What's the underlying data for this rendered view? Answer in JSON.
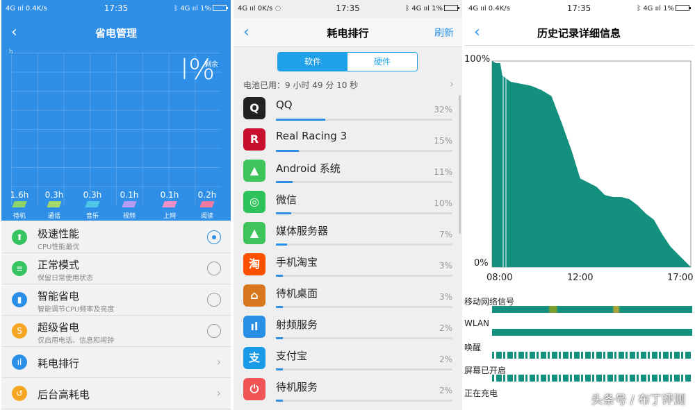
{
  "panel1": {
    "status": {
      "left": "4G ııl 0.4K/s",
      "time": "17:35",
      "right": "ᛒ 4G ııl 1%"
    },
    "title": "省电管理",
    "back": "‹",
    "axis_h": "h",
    "percent": "l%",
    "remain": "剩余",
    "usage": [
      {
        "value": "1.6h",
        "label": "待机",
        "color": "#8fd36b"
      },
      {
        "value": "0.3h",
        "label": "通话",
        "color": "#a5d86a"
      },
      {
        "value": "0.3h",
        "label": "音乐",
        "color": "#4fc6e8"
      },
      {
        "value": "0.1h",
        "label": "视频",
        "color": "#b69af0"
      },
      {
        "value": "0.1h",
        "label": "上网",
        "color": "#f08fc8"
      },
      {
        "value": "0.2h",
        "label": "阅读",
        "color": "#f07aa0"
      }
    ],
    "modes": [
      {
        "title": "极速性能",
        "sub": "CPU性能最优",
        "icon": "rocket-icon",
        "glyph": "⬆",
        "color": "#35c460",
        "kind": "radio",
        "selected": true
      },
      {
        "title": "正常模式",
        "sub": "保留日常使用状态",
        "icon": "list-icon",
        "glyph": "≡",
        "color": "#35c460",
        "kind": "radio",
        "selected": false
      },
      {
        "title": "智能省电",
        "sub": "智能调节CPU频率及亮度",
        "icon": "battery-icon",
        "glyph": "▮",
        "color": "#2a8fe6",
        "kind": "radio",
        "selected": false
      },
      {
        "title": "超级省电",
        "sub": "仅启用电话、信息和闹钟",
        "icon": "save-icon",
        "glyph": "S",
        "color": "#f5a623",
        "kind": "radio",
        "selected": false
      },
      {
        "title": "耗电排行",
        "sub": "",
        "icon": "bar-chart-icon",
        "glyph": "ıl",
        "color": "#2a8fe6",
        "kind": "link",
        "selected": false
      },
      {
        "title": "后台高耗电",
        "sub": "",
        "icon": "refresh-icon",
        "glyph": "↺",
        "color": "#f5a623",
        "kind": "link",
        "selected": false
      }
    ]
  },
  "panel2": {
    "status": {
      "left": "4G ııl 0K/s ◌",
      "time": "17:35",
      "right": "ᛒ 4G ııl 1%"
    },
    "title": "耗电排行",
    "back": "‹",
    "refresh": "刷新",
    "tabs": [
      "软件",
      "硬件"
    ],
    "battery_used": "电池已用：9 小时 49 分 10 秒",
    "apps": [
      {
        "name": "QQ",
        "percent": "32%",
        "value": 32,
        "icon": "qq-icon",
        "glyph": "Q",
        "color": "#222"
      },
      {
        "name": "Real Racing 3",
        "percent": "15%",
        "value": 15,
        "icon": "real-racing-icon",
        "glyph": "R",
        "color": "#c8102e"
      },
      {
        "name": "Android 系统",
        "percent": "11%",
        "value": 11,
        "icon": "android-icon",
        "glyph": "▲",
        "color": "#3ec45a"
      },
      {
        "name": "微信",
        "percent": "10%",
        "value": 10,
        "icon": "wechat-icon",
        "glyph": "◎",
        "color": "#2ec25b"
      },
      {
        "name": "媒体服务器",
        "percent": "7%",
        "value": 7,
        "icon": "android-icon",
        "glyph": "▲",
        "color": "#3ec45a"
      },
      {
        "name": "手机淘宝",
        "percent": "3%",
        "value": 3,
        "icon": "taobao-icon",
        "glyph": "淘",
        "color": "#ff5000"
      },
      {
        "name": "待机桌面",
        "percent": "3%",
        "value": 3,
        "icon": "home-icon",
        "glyph": "⌂",
        "color": "#d9771e"
      },
      {
        "name": "射频服务",
        "percent": "2%",
        "value": 2,
        "icon": "signal-icon",
        "glyph": "ıl",
        "color": "#2a8fe6"
      },
      {
        "name": "支付宝",
        "percent": "2%",
        "value": 2,
        "icon": "alipay-icon",
        "glyph": "支",
        "color": "#1a9be8"
      },
      {
        "name": "待机服务",
        "percent": "2%",
        "value": 2,
        "icon": "power-icon",
        "glyph": "⏻",
        "color": "#f05454"
      }
    ]
  },
  "panel3": {
    "status": {
      "left": "4G ııl 0.4K/s",
      "time": "17:35",
      "right": "ᛒ 4G ııl 1%"
    },
    "title": "历史记录详细信息",
    "back": "‹",
    "chart_data": {
      "type": "area",
      "x_ticks": [
        "08:00",
        "12:00",
        "17:00"
      ],
      "y_ticks": [
        "100%",
        "0%"
      ],
      "series_color": "#13907e",
      "x_hours": [
        7.6,
        7.8,
        8.0,
        8.1,
        8.5,
        9.0,
        9.5,
        10.0,
        10.5,
        11.0,
        11.5,
        11.9,
        12.3,
        12.7,
        13.1,
        13.5,
        13.9,
        14.3,
        14.7,
        15.1,
        15.5,
        15.9,
        16.3,
        16.7,
        17.0,
        17.3
      ],
      "y_percent": [
        100,
        99,
        99,
        93,
        90,
        89,
        88,
        86,
        83,
        70,
        56,
        43,
        41,
        39,
        35,
        34,
        34,
        33,
        30,
        26,
        23,
        16,
        10,
        6,
        3,
        0
      ],
      "x_range": [
        7.6,
        17.3
      ],
      "y_range": [
        0,
        100
      ]
    },
    "signals": [
      {
        "label": "移动网络信号",
        "color": "#13907e",
        "pattern": "mixed"
      },
      {
        "label": "WLAN",
        "color": "#13907e",
        "pattern": "solid"
      },
      {
        "label": "唤醒",
        "color": "#13907e",
        "pattern": "stripes"
      },
      {
        "label": "屏幕已开启",
        "color": "#13907e",
        "pattern": "stripes"
      },
      {
        "label": "正在充电",
        "color": "#13907e",
        "pattern": "none"
      }
    ],
    "watermark": "头条号 / 布丁评测"
  }
}
